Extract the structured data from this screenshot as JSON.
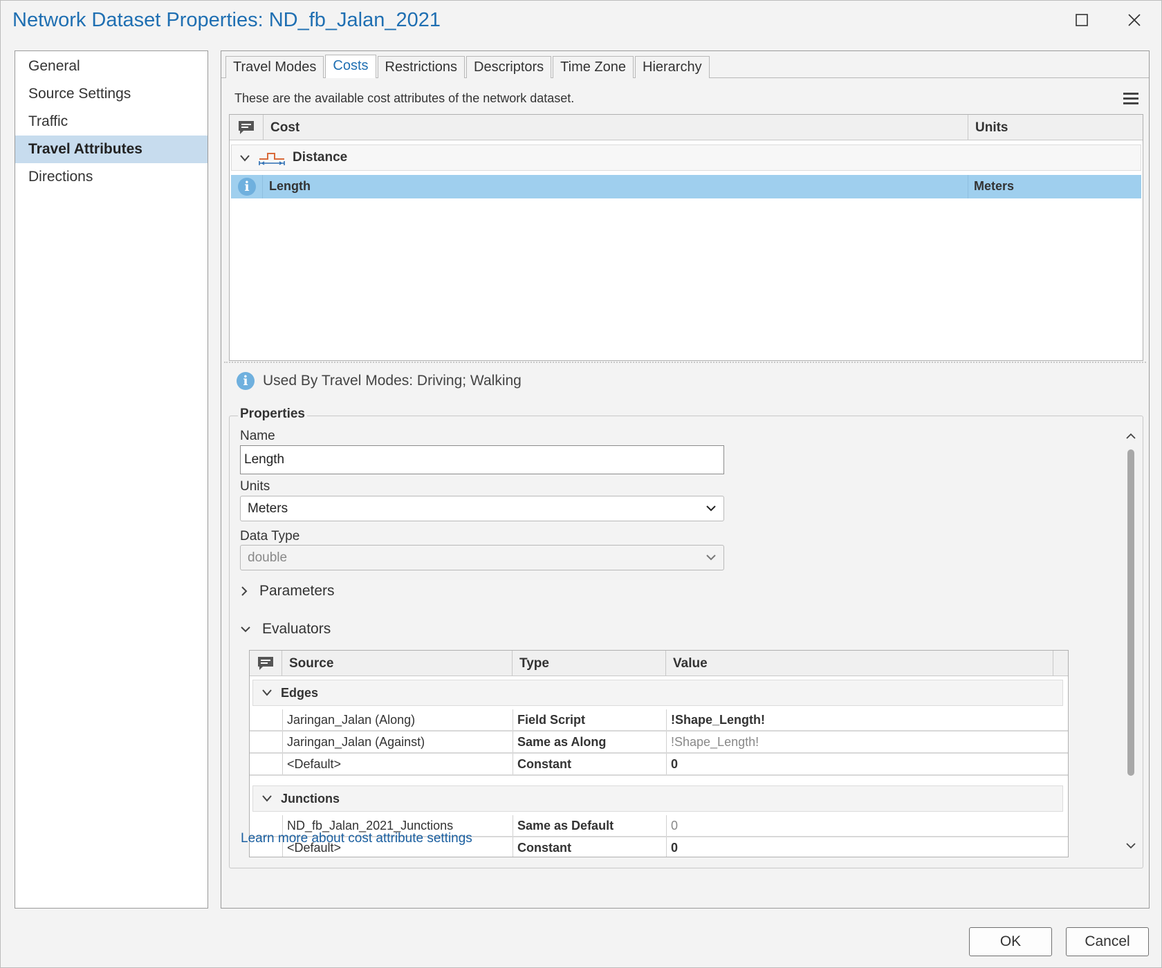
{
  "window": {
    "title": "Network Dataset Properties: ND_fb_Jalan_2021"
  },
  "sidebar": {
    "items": [
      {
        "label": "General"
      },
      {
        "label": "Source Settings"
      },
      {
        "label": "Traffic"
      },
      {
        "label": "Travel Attributes",
        "active": true
      },
      {
        "label": "Directions"
      }
    ]
  },
  "tabs": [
    {
      "label": "Travel Modes"
    },
    {
      "label": "Costs",
      "active": true
    },
    {
      "label": "Restrictions"
    },
    {
      "label": "Descriptors"
    },
    {
      "label": "Time Zone"
    },
    {
      "label": "Hierarchy"
    }
  ],
  "costs": {
    "subtitle": "These are the available cost attributes of the network dataset.",
    "columns": {
      "cost": "Cost",
      "units": "Units"
    },
    "group": "Distance",
    "selected_row": {
      "name": "Length",
      "units": "Meters"
    }
  },
  "used_by": "Used By Travel Modes: Driving; Walking",
  "properties": {
    "legend": "Properties",
    "name_label": "Name",
    "name_value": "Length",
    "units_label": "Units",
    "units_value": "Meters",
    "datatype_label": "Data Type",
    "datatype_value": "double",
    "parameters_label": "Parameters",
    "evaluators_label": "Evaluators"
  },
  "evaluators": {
    "columns": {
      "source": "Source",
      "type": "Type",
      "value": "Value"
    },
    "edges_label": "Edges",
    "edges": [
      {
        "source": "Jaringan_Jalan (Along)",
        "type": "Field Script",
        "value": "!Shape_Length!",
        "muted": false
      },
      {
        "source": "Jaringan_Jalan (Against)",
        "type": "Same as Along",
        "value": "!Shape_Length!",
        "muted": true
      },
      {
        "source": "<Default>",
        "type": "Constant",
        "value": "0",
        "muted": false
      }
    ],
    "junctions_label": "Junctions",
    "junctions": [
      {
        "source": "ND_fb_Jalan_2021_Junctions",
        "type": "Same as Default",
        "value": "0",
        "muted": true
      },
      {
        "source": "<Default>",
        "type": "Constant",
        "value": "0",
        "muted": false
      }
    ]
  },
  "learn_more": "Learn more about cost attribute settings",
  "buttons": {
    "ok": "OK",
    "cancel": "Cancel"
  },
  "colors": {
    "accent": "#1f6fb2",
    "selection": "#9fcfee",
    "nav_active": "#c7dcee"
  }
}
